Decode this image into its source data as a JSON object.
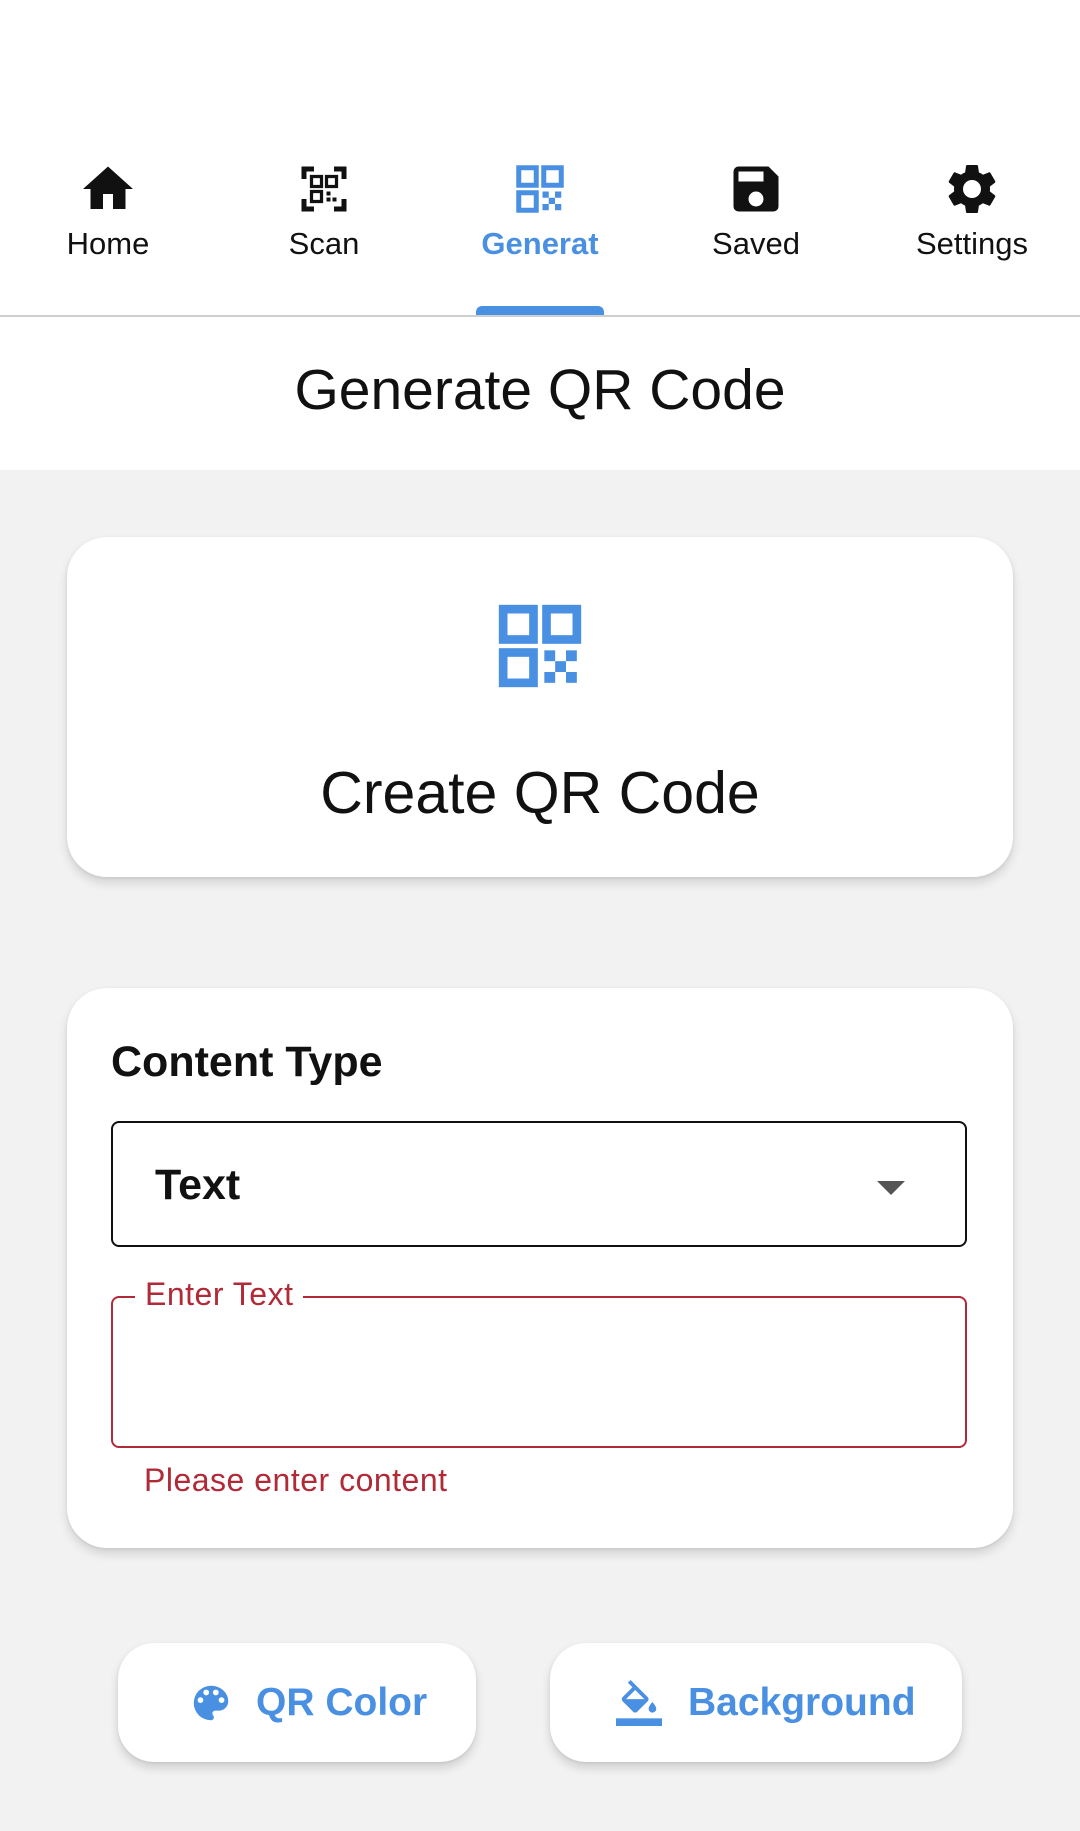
{
  "tabs": [
    {
      "label": "Home",
      "icon": "home-icon"
    },
    {
      "label": "Scan",
      "icon": "qr-scan-icon"
    },
    {
      "label": "Generat",
      "icon": "qr-code-icon",
      "active": true
    },
    {
      "label": "Saved",
      "icon": "save-icon"
    },
    {
      "label": "Settings",
      "icon": "gear-icon"
    }
  ],
  "header": {
    "title": "Generate QR Code"
  },
  "hero": {
    "title": "Create QR Code",
    "icon": "qr-code-icon"
  },
  "form": {
    "content_type_label": "Content Type",
    "content_type_value": "Text",
    "input_label": "Enter Text",
    "input_value": "",
    "error_message": "Please enter content"
  },
  "buttons": {
    "qr_color": "QR Color",
    "background": "Background"
  },
  "colors": {
    "accent": "#4a90e2",
    "error": "#b02a37",
    "page_background": "#f2f2f2"
  }
}
